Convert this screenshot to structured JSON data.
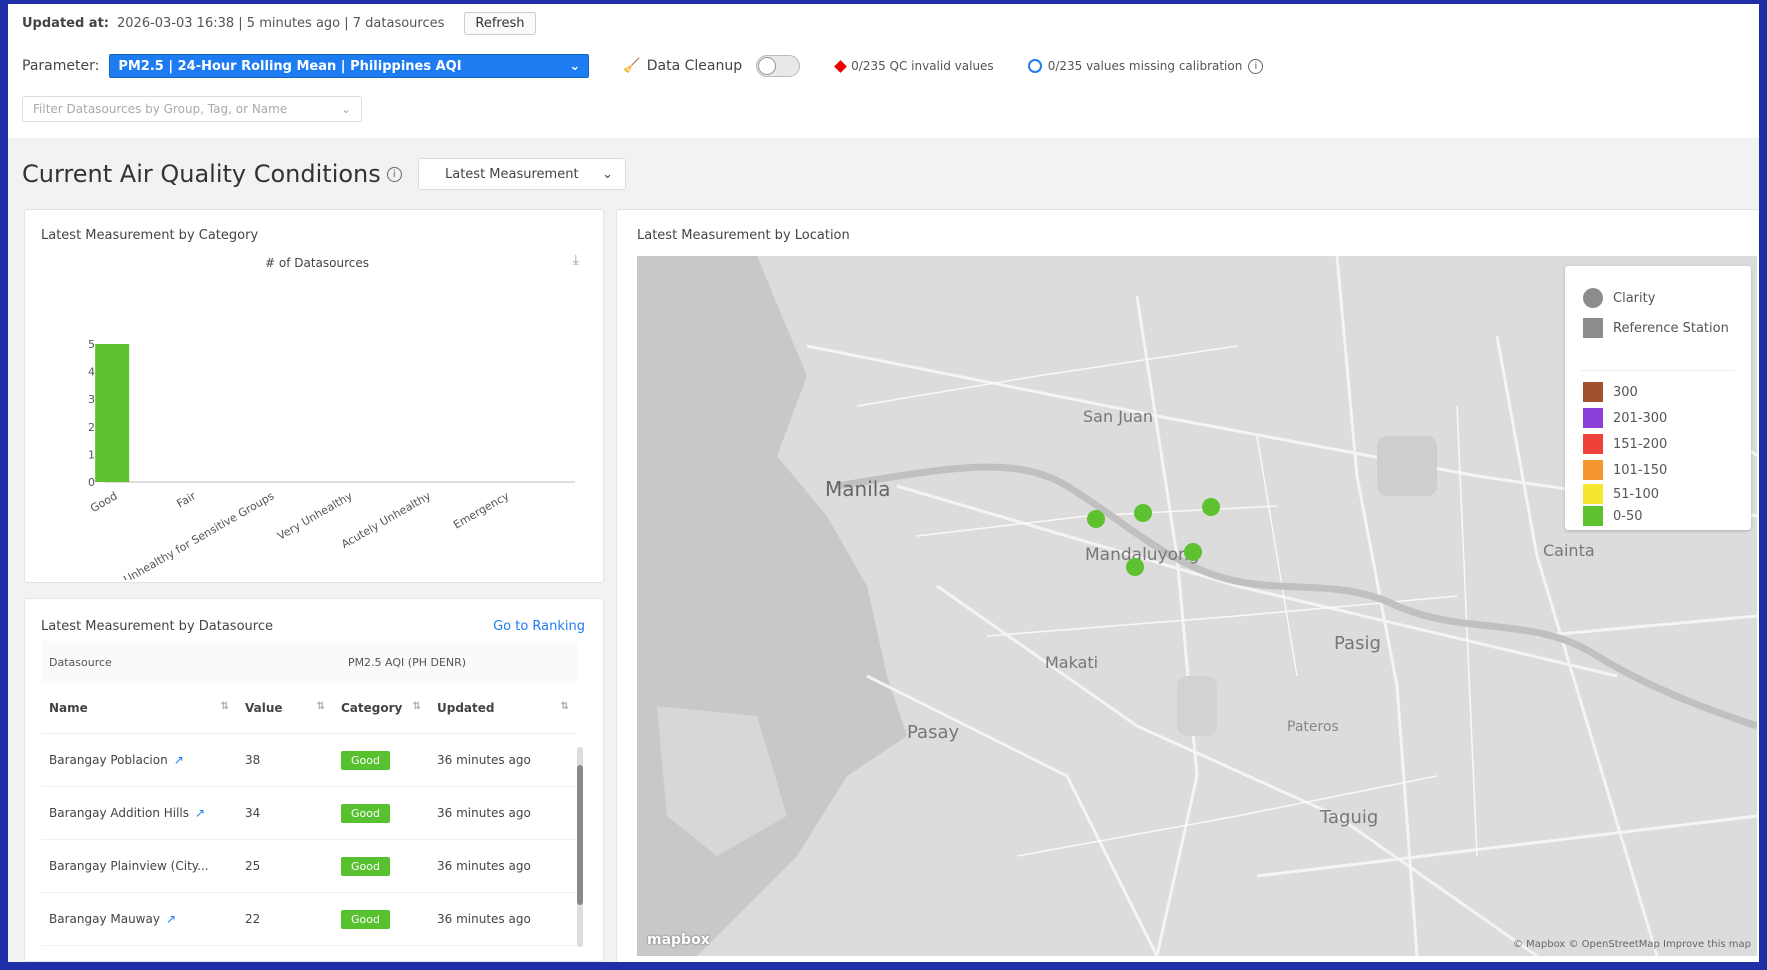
{
  "header": {
    "updated_label": "Updated at:",
    "updated_value": "2026-03-03 16:38 | 5 minutes ago | 7 datasources",
    "refresh_label": "Refresh",
    "parameter_label": "Parameter:",
    "parameter_value": "PM2.5 | 24-Hour Rolling Mean | Philippines AQI",
    "data_cleanup_label": "Data Cleanup",
    "qc_invalid": "0/235 QC invalid values",
    "missing_calibration": "0/235 values missing calibration",
    "filter_placeholder": "Filter Datasources by Group, Tag, or Name"
  },
  "section": {
    "title": "Current Air Quality Conditions",
    "measurement_select": "Latest Measurement"
  },
  "category_chart": {
    "card_title": "Latest Measurement by Category",
    "chart_title": "# of Datasources"
  },
  "chart_data": {
    "type": "bar",
    "title": "# of Datasources",
    "categories": [
      "Good",
      "Fair",
      "Unhealthy for Sensitive Groups",
      "Very Unhealthy",
      "Acutely Unhealthy",
      "Emergency"
    ],
    "values": [
      5,
      0,
      0,
      0,
      0,
      0
    ],
    "ylim": [
      0,
      5
    ],
    "yticks": [
      "0",
      "1",
      "2",
      "3",
      "4",
      "5"
    ],
    "bar_color": "#5ec12f"
  },
  "table": {
    "card_title": "Latest Measurement by Datasource",
    "ranking_link": "Go to Ranking",
    "col_datasource": "Datasource",
    "col_group": "PM2.5 AQI (PH DENR)",
    "col_name": "Name",
    "col_value": "Value",
    "col_category": "Category",
    "col_updated": "Updated",
    "rows": [
      {
        "name": "Barangay Poblacion",
        "value": "38",
        "category": "Good",
        "updated": "36 minutes ago"
      },
      {
        "name": "Barangay Addition Hills",
        "value": "34",
        "category": "Good",
        "updated": "36 minutes ago"
      },
      {
        "name": "Barangay Plainview (City...",
        "value": "25",
        "category": "Good",
        "updated": "36 minutes ago"
      },
      {
        "name": "Barangay Mauway",
        "value": "22",
        "category": "Good",
        "updated": "36 minutes ago"
      }
    ]
  },
  "map": {
    "card_title": "Latest Measurement by Location",
    "places": [
      "Manila",
      "San Juan",
      "Mandaluyong",
      "Makati",
      "Pasay",
      "Pasig",
      "Pateros",
      "Taguig",
      "Cainta"
    ],
    "legend_clarity": "Clarity",
    "legend_reference": "Reference Station",
    "legend_ranges": [
      {
        "label": "300",
        "color": "#a0522d"
      },
      {
        "label": "201-300",
        "color": "#8b3fd9"
      },
      {
        "label": "151-200",
        "color": "#f0403a"
      },
      {
        "label": "101-150",
        "color": "#f5962e"
      },
      {
        "label": "51-100",
        "color": "#f5e62e"
      },
      {
        "label": "0-50",
        "color": "#5ec12f"
      }
    ],
    "attribution": "© Mapbox © OpenStreetMap Improve this map",
    "logo": "mapbox"
  }
}
